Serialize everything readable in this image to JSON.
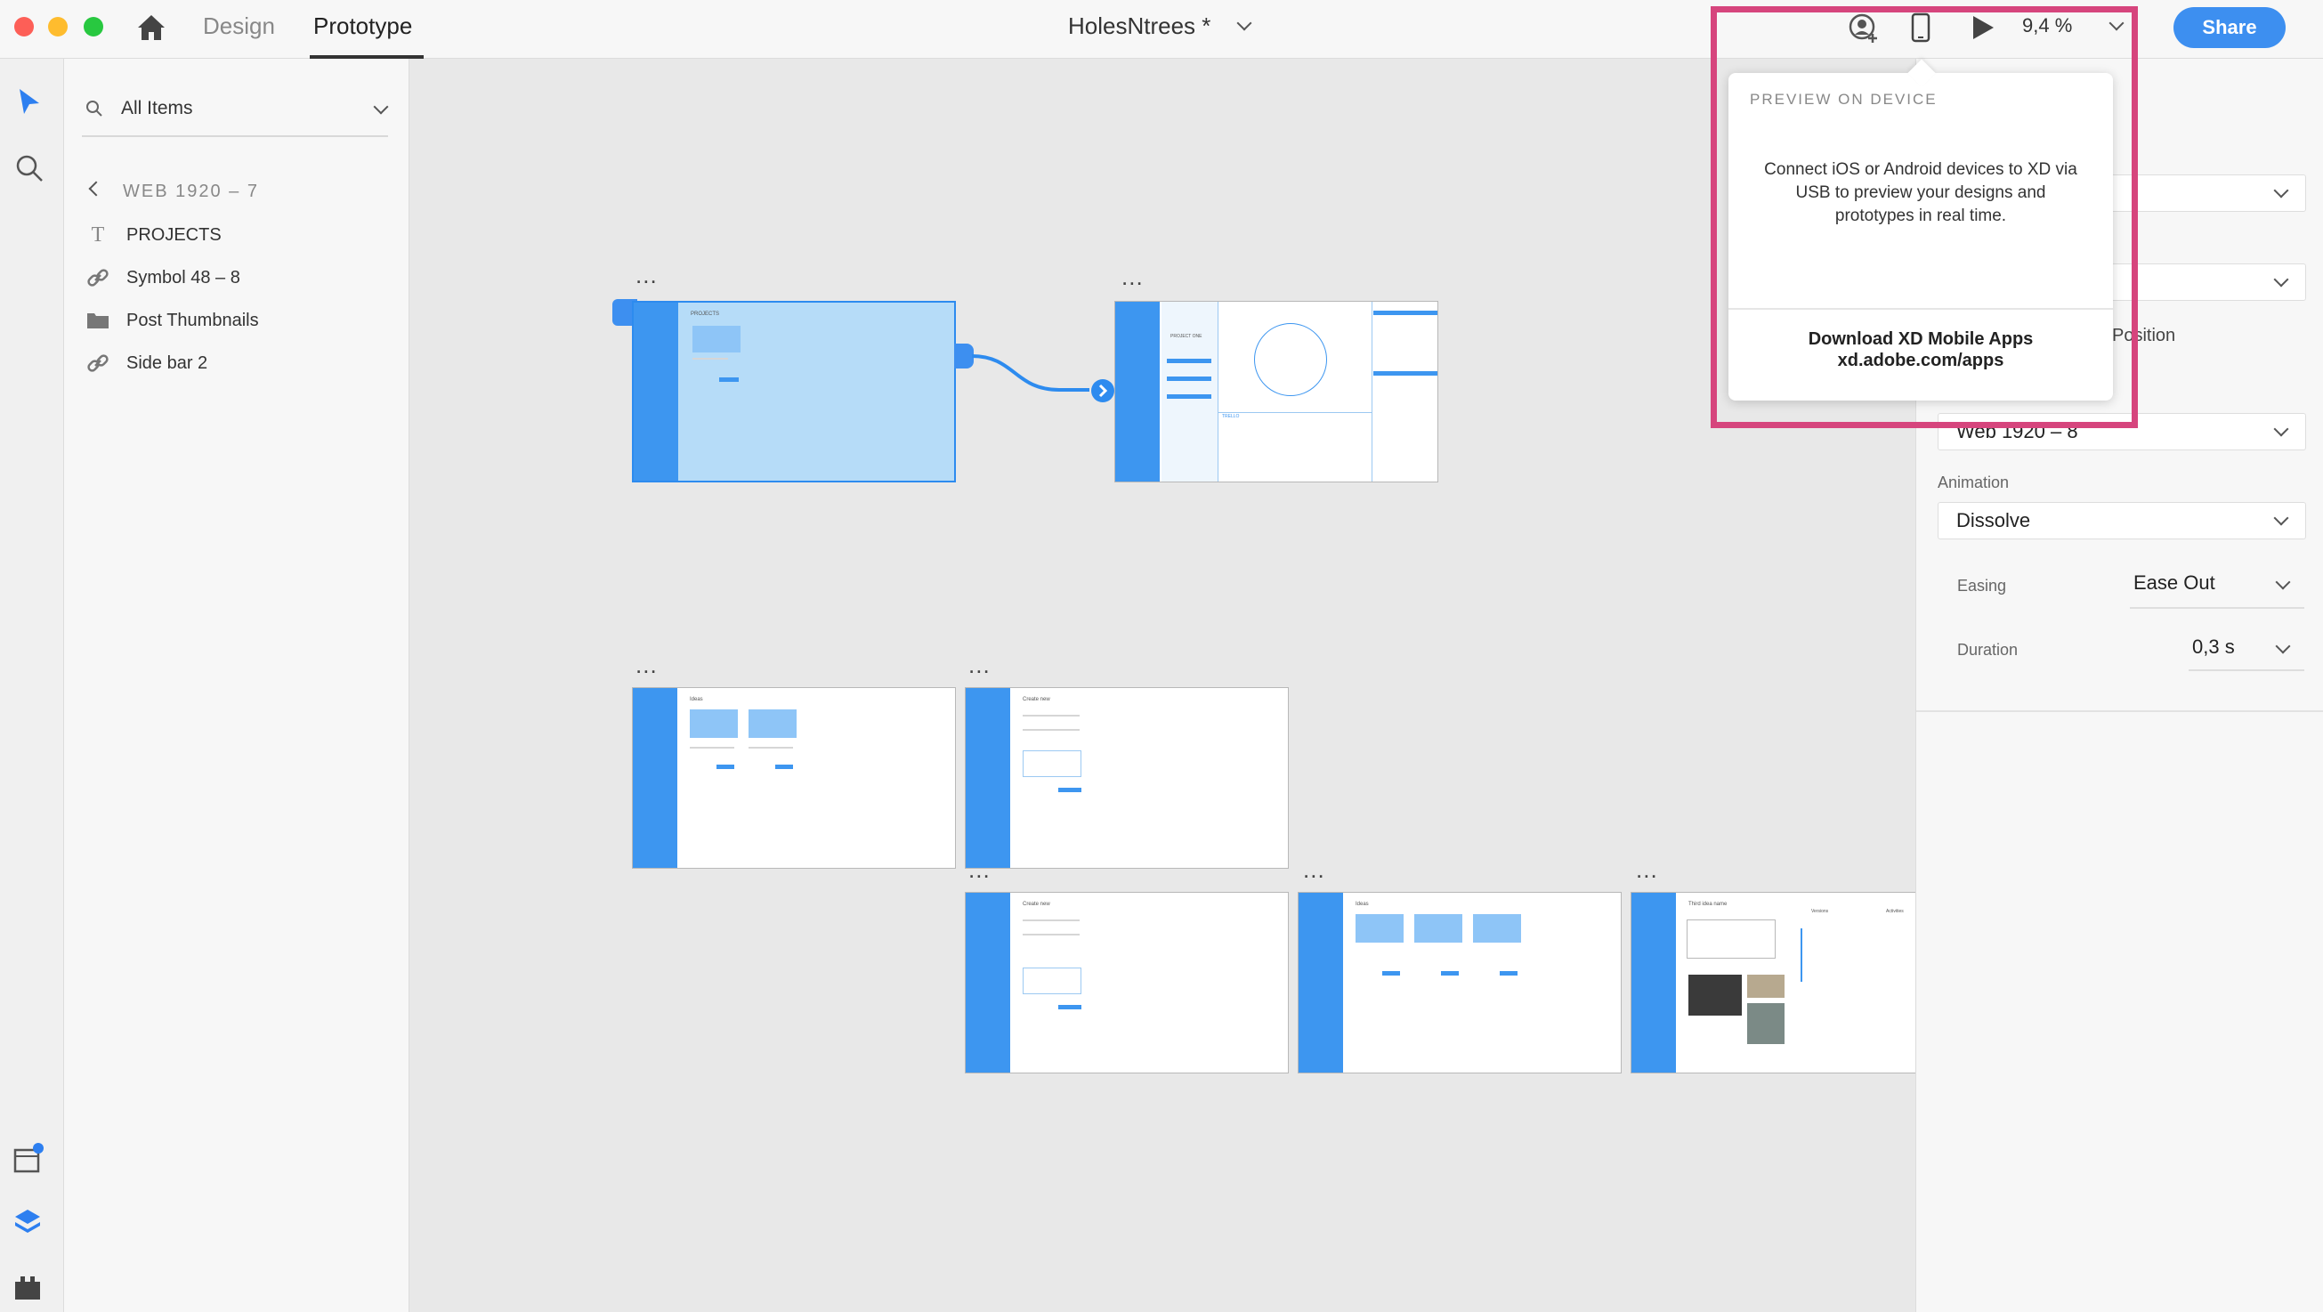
{
  "app": {
    "tabs": [
      {
        "label": "Design"
      },
      {
        "label": "Prototype"
      }
    ],
    "document_title": "HolesNtrees *",
    "zoom": "9,4 %",
    "share_label": "Share",
    "accent": "#3d96f0",
    "highlight_color": "#d6457d"
  },
  "layers": {
    "filter_label": "All Items",
    "breadcrumb": "WEB 1920 – 7",
    "items": [
      {
        "label": "PROJECTS",
        "icon": "text-icon"
      },
      {
        "label": "Symbol 48 – 8",
        "icon": "link-icon"
      },
      {
        "label": "Post Thumbnails",
        "icon": "folder-icon"
      },
      {
        "label": "Side bar 2",
        "icon": "link-icon"
      }
    ]
  },
  "popover": {
    "title": "PREVIEW ON DEVICE",
    "body": "Connect iOS or Android devices to XD via USB to preview your designs and prototypes in real time.",
    "download_title": "Download XD Mobile Apps",
    "download_url": "xd.adobe.com/apps"
  },
  "inspector": {
    "partial_label": "l Position",
    "destination": "Web 1920 – 8",
    "animation_label": "Animation",
    "animation_value": "Dissolve",
    "easing_label": "Easing",
    "easing_value": "Ease Out",
    "duration_label": "Duration",
    "duration_value": "0,3 s"
  },
  "canvas": {
    "artboard_menu": "...",
    "artboard_texts": {
      "projects": "PROJECTS",
      "project_one": "PROJECT ONE",
      "trello": "TRELLO",
      "ideas": "Ideas",
      "create_new": "Create new",
      "third_idea": "Third idea name",
      "versions": "Versions",
      "activities": "Activities"
    }
  }
}
